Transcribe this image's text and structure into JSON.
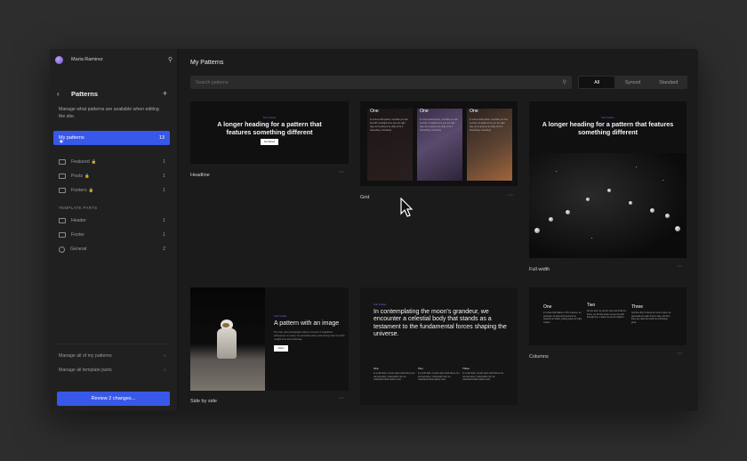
{
  "user": {
    "name": "Maria Ramirez"
  },
  "sidebar": {
    "title": "Patterns",
    "description": "Manage what patterns are available when editing the site.",
    "active": {
      "label": "My patterns",
      "count": "13"
    },
    "items": [
      {
        "label": "Featured",
        "count": "1"
      },
      {
        "label": "Posts",
        "count": "1"
      },
      {
        "label": "Footers",
        "count": "1"
      }
    ],
    "section_label": "TEMPLATE PARTS",
    "parts": [
      {
        "label": "Header",
        "count": "1"
      },
      {
        "label": "Footer",
        "count": "1"
      },
      {
        "label": "General",
        "count": "2"
      }
    ],
    "manage_links": [
      "Manage all of my patterns",
      "Manage all template parts"
    ],
    "review_button": "Review 2 changes..."
  },
  "main": {
    "title": "My Patterns",
    "search_placeholder": "Search patterns",
    "filters": [
      "All",
      "Synced",
      "Standard"
    ],
    "active_filter": "All"
  },
  "cards": [
    {
      "label": "Headline",
      "tag": "Sub header",
      "heading": "A longer heading for a pattern that features something different",
      "button": "Get Started"
    },
    {
      "label": "Grid",
      "columns": [
        {
          "title": "One",
          "text": "In a three-fold quarter, moonlike you can be bold, it's alright to be you, the right way, we're going to be okay to be it. Something, something."
        },
        {
          "title": "One",
          "text": "In a three-fold quarter, moonlike you can be bold, it's alright to be you, the right way, we're going to be okay to be it. Something, something."
        },
        {
          "title": "One",
          "text": "In a three-fold quarter, moonlike you can be bold, it's alright to be you, the right way, we're going to be okay to be it. Something, something."
        }
      ]
    },
    {
      "label": "Full width",
      "tag": "Sub header",
      "heading": "A longer heading for a pattern that features something different"
    },
    {
      "label": "Side by side",
      "tag": "Sub header",
      "heading": "A pattern with an image",
      "text": "The crisp, silent photographs capture a moment of magnificent achievement. In unison, the astronauts stand, suits shining under the harsh sunlight of an alien landscape.",
      "button": "Action"
    },
    {
      "label": "",
      "tag": "Sub header",
      "heading": "In contemplating the moon's grandeur, we encounter a celestial body that stands as a testament to the fundamental forces shaping the universe.",
      "columns": [
        {
          "title": "One",
          "text": "In a calm field, a small, quiet world where one can feel alone. Underneath it all, we understand what matters most."
        },
        {
          "title": "Two",
          "text": "In a calm field, a small, quiet world where one can feel alone. Underneath it all, we understand what matters most."
        },
        {
          "title": "Three",
          "text": "In a calm field, a small, quiet world where one can feel alone. Underneath it all, we understand what matters most."
        }
      ]
    },
    {
      "label": "Columns",
      "columns": [
        {
          "title": "One",
          "text": "In a three-fold balance of the universe, an expansion of elements becomes the blueprint we follow, making space for what matters."
        },
        {
          "title": "Two",
          "text": "We are kind, we are the ones who build the future, we find the steps, we see the path through time, a place we can be together."
        },
        {
          "title": "Three",
          "text": "And the other is where we come to give, we appreciate the path, find our way, and from there we make the world into something good."
        }
      ]
    }
  ],
  "icons": {
    "search": "search-icon",
    "back": "chevron-left-icon",
    "add": "plus-icon",
    "star": "star-icon",
    "folder": "folder-icon",
    "lock": "lock-icon",
    "layout": "layout-icon",
    "more": "more-icon",
    "cursor": "cursor-icon"
  },
  "colors": {
    "accent": "#3858e9",
    "background": "#1b1b1b",
    "sidebar": "#202020"
  }
}
